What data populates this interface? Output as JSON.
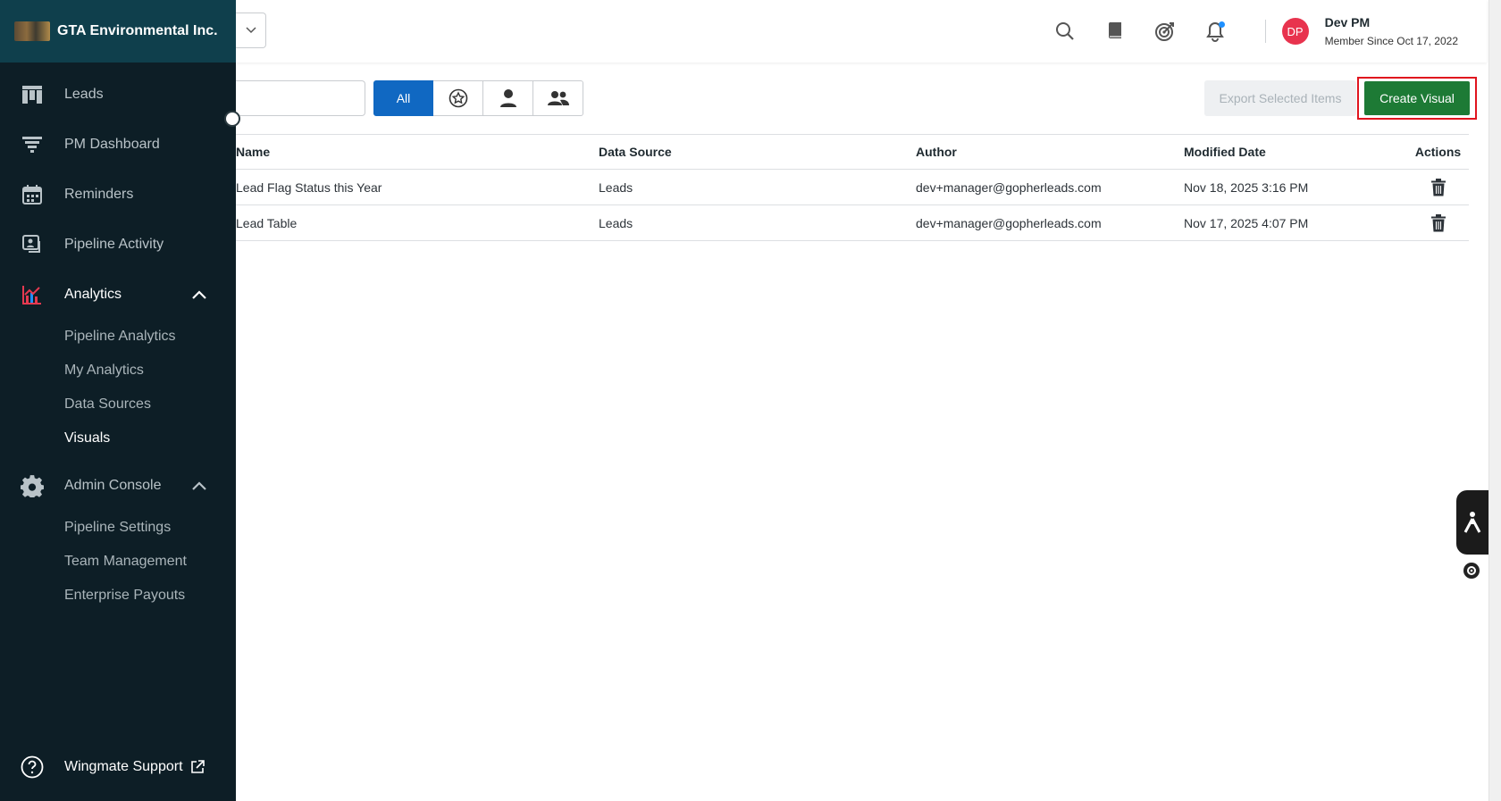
{
  "brand": {
    "name": "GTA Environmental Inc."
  },
  "sidebar": {
    "items": [
      {
        "label": "Leads",
        "icon": "leads-board-icon"
      },
      {
        "label": "PM Dashboard",
        "icon": "funnel-icon"
      },
      {
        "label": "Reminders",
        "icon": "calendar-icon"
      },
      {
        "label": "Pipeline Activity",
        "icon": "activity-icon"
      },
      {
        "label": "Analytics",
        "icon": "chart-icon"
      },
      {
        "label": "Admin Console",
        "icon": "gear-icon"
      }
    ],
    "analytics_sub": [
      "Pipeline Analytics",
      "My Analytics",
      "Data Sources",
      "Visuals"
    ],
    "admin_sub": [
      "Pipeline Settings",
      "Team Management",
      "Enterprise Payouts"
    ],
    "support_label": "Wingmate Support"
  },
  "header": {
    "user_initials": "DP",
    "user_name": "Dev PM",
    "member_since": "Member Since Oct 17, 2022",
    "accent_avatar": "#e8334e"
  },
  "toolbar": {
    "filter_all": "All",
    "export_label": "Export Selected Items",
    "create_label": "Create Visual"
  },
  "table": {
    "headers": [
      "Name",
      "Data Source",
      "Author",
      "Modified Date",
      "Actions"
    ],
    "rows": [
      {
        "name": "Lead Flag Status this Year",
        "source": "Leads",
        "author": "dev+manager@gopherleads.com",
        "modified": "Nov 18, 2025 3:16 PM"
      },
      {
        "name": "Lead Table",
        "source": "Leads",
        "author": "dev+manager@gopherleads.com",
        "modified": "Nov 17, 2025 4:07 PM"
      }
    ]
  },
  "colors": {
    "sidebar_bg": "#0d1e26",
    "brand_bg": "#0f3f4c",
    "primary_blue": "#1068c2",
    "create_green": "#1d7a35",
    "highlight_red": "#e0141e"
  }
}
